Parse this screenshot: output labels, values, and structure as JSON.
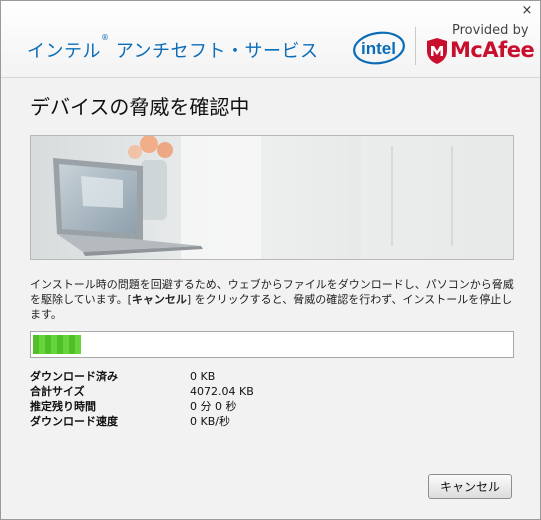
{
  "window": {
    "title": "インテル",
    "title_mark": "®",
    "title_rest": " アンチセフト・サービス",
    "close_glyph": "×"
  },
  "branding": {
    "intel_logo_text": "intel",
    "provided_by": "Provided by",
    "mcafee_text": "McAfee",
    "intel_color": "#0b6db8",
    "mcafee_color": "#c8102e"
  },
  "main": {
    "heading": "デバイスの脅威を確認中",
    "description_part1": "インストール時の問題を回避するため、ウェブからファイルをダウンロードし、パソコンから脅威を駆除しています。[",
    "description_bold": "キャンセル",
    "description_part2": "] をクリックすると、脅威の確認を行わず、インストールを停止します。"
  },
  "progress": {
    "fraction": 0.1,
    "color": "#4fc02a"
  },
  "stats": [
    {
      "label": "ダウンロード済み",
      "value": "0 KB"
    },
    {
      "label": "合計サイズ",
      "value": "4072.04 KB"
    },
    {
      "label": "推定残り時間",
      "value": "0 分 0 秒"
    },
    {
      "label": "ダウンロード速度",
      "value": "0 KB/秒"
    }
  ],
  "buttons": {
    "cancel": "キャンセル"
  }
}
